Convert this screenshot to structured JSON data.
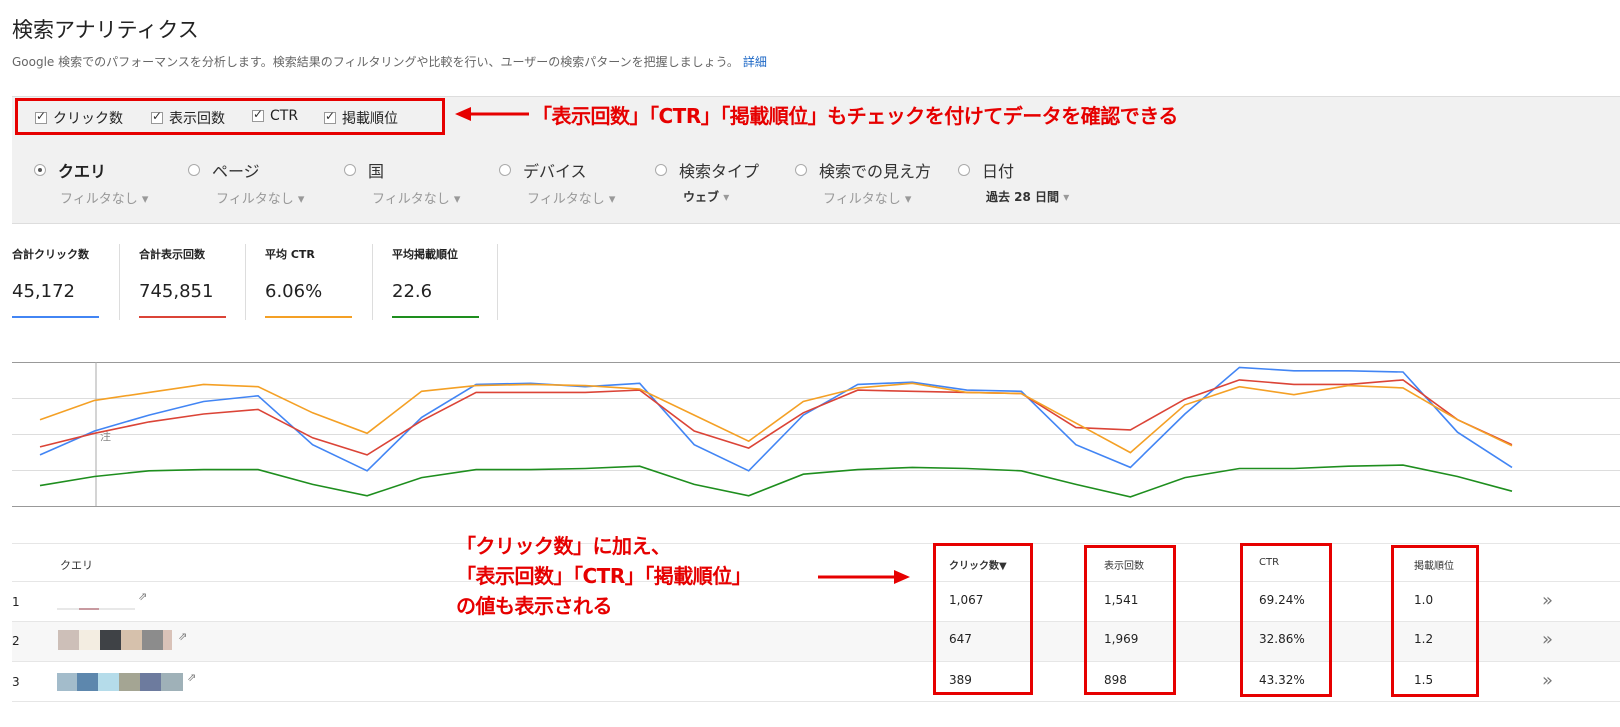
{
  "header": {
    "title": "検索アナリティクス",
    "description": "Google 検索でのパフォーマンスを分析します。検索結果のフィルタリングや比較を行い、ユーザーの検索パターンを把握しましょう。",
    "details_link": "詳細"
  },
  "metric_toggles": [
    {
      "label": "クリック数",
      "checked": true
    },
    {
      "label": "表示回数",
      "checked": true
    },
    {
      "label": "CTR",
      "checked": true
    },
    {
      "label": "掲載順位",
      "checked": true
    }
  ],
  "annotations": {
    "top": "「表示回数」「CTR」「掲載順位」もチェックを付けてデータを確認できる",
    "bottom_line1": "「クリック数」に加え、",
    "bottom_line2": "「表示回数」「CTR」「掲載順位」",
    "bottom_line3": "の値も表示される",
    "chart_note": "注"
  },
  "dimensions": [
    {
      "label": "クエリ",
      "filter": "フィルタなし",
      "selected": true
    },
    {
      "label": "ページ",
      "filter": "フィルタなし",
      "selected": false
    },
    {
      "label": "国",
      "filter": "フィルタなし",
      "selected": false
    },
    {
      "label": "デバイス",
      "filter": "フィルタなし",
      "selected": false
    },
    {
      "label": "検索タイプ",
      "filter": "ウェブ",
      "selected": false
    },
    {
      "label": "検索での見え方",
      "filter": "フィルタなし",
      "selected": false
    },
    {
      "label": "日付",
      "filter": "過去 28 日間",
      "selected": false
    }
  ],
  "summary": [
    {
      "label": "合計クリック数",
      "value": "45,172",
      "color": "#4285f4"
    },
    {
      "label": "合計表示回数",
      "value": "745,851",
      "color": "#db4437"
    },
    {
      "label": "平均 CTR",
      "value": "6.06%",
      "color": "#f4a025"
    },
    {
      "label": "平均掲載順位",
      "value": "22.6",
      "color": "#1e8e1e"
    }
  ],
  "chart_data": {
    "type": "line",
    "x": [
      1,
      2,
      3,
      4,
      5,
      6,
      7,
      8,
      9,
      10,
      11,
      12,
      13,
      14,
      15,
      16,
      17,
      18,
      19,
      20,
      21,
      22,
      23,
      24,
      25,
      26,
      27,
      28
    ],
    "series": [
      {
        "name": "クリック数",
        "color": "#4285f4",
        "values": [
          45,
          66,
          80,
          92,
          97,
          54,
          31,
          78,
          107,
          108,
          105,
          108,
          54,
          31,
          80,
          107,
          109,
          102,
          101,
          54,
          34,
          81,
          122,
          119,
          119,
          118,
          65,
          34
        ]
      },
      {
        "name": "表示回数",
        "color": "#db4437",
        "values": [
          52,
          64,
          74,
          81,
          85,
          60,
          45,
          75,
          100,
          100,
          100,
          102,
          66,
          51,
          82,
          102,
          101,
          100,
          99,
          69,
          67,
          94,
          111,
          107,
          107,
          111,
          76,
          54
        ]
      },
      {
        "name": "CTR",
        "color": "#f4a025",
        "values": [
          76,
          93,
          100,
          107,
          105,
          82,
          64,
          101,
          106,
          107,
          106,
          103,
          80,
          57,
          92,
          104,
          108,
          100,
          99,
          73,
          47,
          89,
          105,
          98,
          106,
          104,
          76,
          53
        ]
      },
      {
        "name": "掲載順位",
        "color": "#1e8e1e",
        "values": [
          18,
          26,
          31,
          32,
          32,
          19,
          9,
          25,
          32,
          32,
          33,
          35,
          19,
          9,
          28,
          32,
          34,
          33,
          31,
          19,
          8,
          25,
          33,
          33,
          35,
          36,
          26,
          13
        ]
      }
    ],
    "ylim": [
      0,
      125
    ],
    "grid": true
  },
  "table": {
    "headers": {
      "query": "クエリ",
      "clicks": "クリック数▼",
      "impressions": "表示回数",
      "ctr": "CTR",
      "position": "掲載順位"
    },
    "rows": [
      {
        "rank": "1",
        "clicks": "1,067",
        "impressions": "1,541",
        "ctr": "69.24%",
        "position": "1.0"
      },
      {
        "rank": "2",
        "clicks": "647",
        "impressions": "1,969",
        "ctr": "32.86%",
        "position": "1.2"
      },
      {
        "rank": "3",
        "clicks": "389",
        "impressions": "898",
        "ctr": "43.32%",
        "position": "1.5"
      }
    ],
    "more_icon": "»",
    "external_icon": "⇗"
  }
}
